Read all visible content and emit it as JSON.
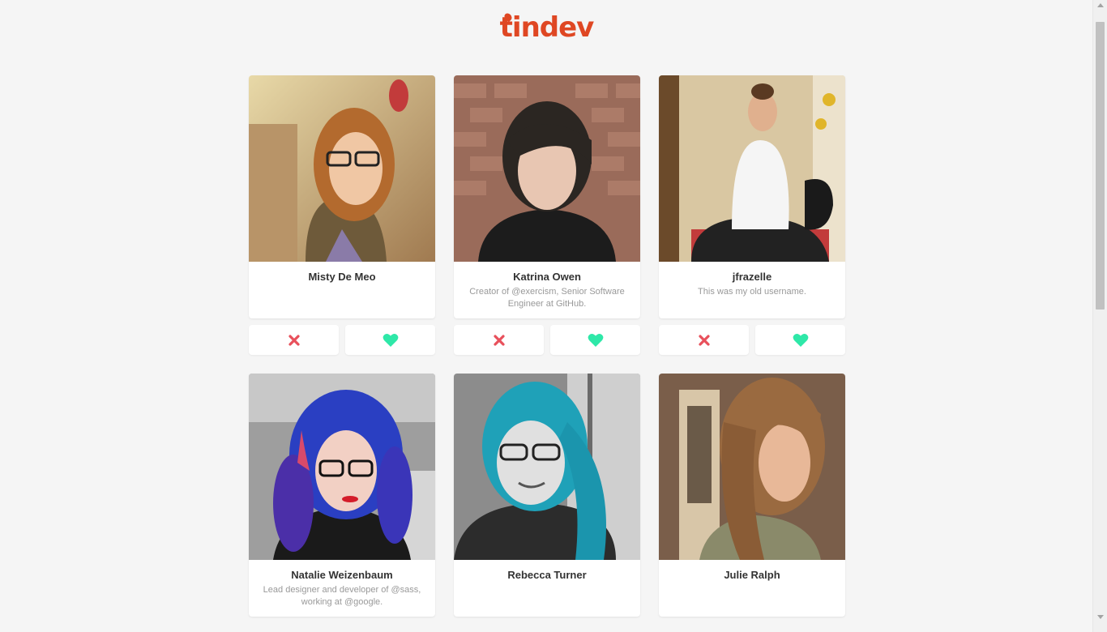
{
  "app": {
    "logo_text": "tindev",
    "brand_color": "#df4723"
  },
  "colors": {
    "dislike": "#e8505b",
    "like": "#2ee8a8"
  },
  "icons": {
    "dislike": "close-icon",
    "like": "heart-icon"
  },
  "developers": [
    {
      "name": "Misty De Meo",
      "bio": ""
    },
    {
      "name": "Katrina Owen",
      "bio": "Creator of @exercism, Senior Software Engineer at GitHub."
    },
    {
      "name": "jfrazelle",
      "bio": "This was my old username."
    },
    {
      "name": "Natalie Weizenbaum",
      "bio": "Lead designer and developer of @sass, working at @google."
    },
    {
      "name": "Rebecca Turner",
      "bio": ""
    },
    {
      "name": "Julie Ralph",
      "bio": ""
    }
  ]
}
